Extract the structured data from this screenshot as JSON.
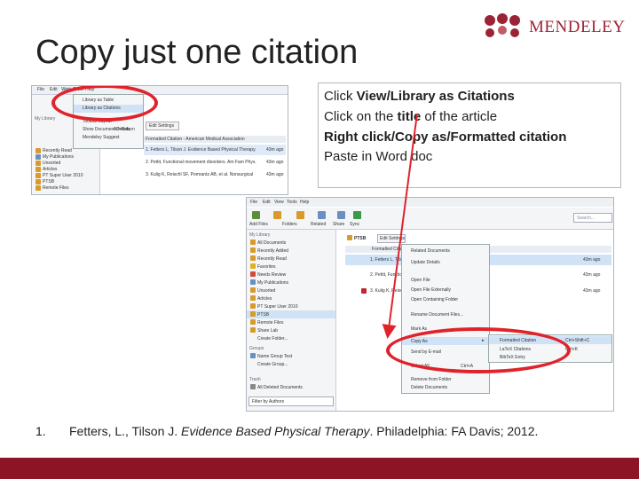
{
  "slide": {
    "title": "Copy just one citation",
    "logo_text": "MENDELEY",
    "brand_color": "#9b2335",
    "bar_color": "#8d1424",
    "annotation_color": "#e0232a"
  },
  "instructions": [
    {
      "text_a": "Click ",
      "text_b": "View/Library as Citations"
    },
    {
      "text_a": "Click on the ",
      "text_b": "title",
      "text_c": " of the article"
    },
    {
      "text_a": "",
      "text_b": "Right click/Copy as/Formatted citation"
    },
    {
      "text_a": "Paste in Word doc",
      "text_b": ""
    }
  ],
  "footnote": {
    "number": "1.",
    "authors": "Fetters, L., Tilson J. ",
    "book_title": "Evidence Based Physical Therapy",
    "publisher": ". Philadelphia: FA Davis; 2012."
  },
  "screenshot1": {
    "menubar": [
      "File",
      "Edit",
      "View",
      "Tools",
      "Help"
    ],
    "cursor_letter": "V",
    "view_menu": [
      "Library as Table",
      "Library as Citations",
      "Toolbar Layout",
      "Show Document Details",
      "Mendeley Suggest"
    ],
    "shortcut": "Alt+Return",
    "sidebar": [
      "My Library",
      "Recently Read",
      "My Publications",
      "Unsorted",
      "Articles",
      "PT Super User 2010",
      "PTSB",
      "Remote Files"
    ],
    "edit_settings": "Edit Settings",
    "style_header": "Formatted Citation - American Medical Association",
    "citations": [
      "1. Fetters L, Tilson J. Evidence Based Physical Therapy.",
      "2. Pettit, Functional movement disorders. Am Fam Phys.",
      "3. Kulig K, Reischl SF, Pomrantz AB, et al. Nonsurgical"
    ],
    "times": [
      "43m ago",
      "43m ago",
      "43m ago"
    ]
  },
  "screenshot2": {
    "menubar": [
      "File",
      "Edit",
      "View",
      "Tools",
      "Help"
    ],
    "toolbar": [
      "Add Files",
      "Folders",
      "Related",
      "Share",
      "Sync"
    ],
    "search_placeholder": "Search...",
    "sidebar_header": "My Library",
    "sidebar": [
      "All Documents",
      "Recently Added",
      "Recently Read",
      "Favorites",
      "Needs Review",
      "My Publications",
      "Unsorted",
      "Articles",
      "PT Super User 2010",
      "PTSB",
      "Remote Files",
      "Share Lab",
      "Create Folder..."
    ],
    "groups_header": "Groups",
    "groups": [
      "Name Group Test",
      "Create Group..."
    ],
    "trash_header": "Trash",
    "trash": [
      "All Deleted Documents"
    ],
    "filter": "Filter by Authors",
    "breadcrumb": "PTSB",
    "edit_settings": "Edit Settings",
    "style_header": "Formatted Citation - American Medical Association",
    "rows": [
      "1. Fetters L, Tilson J. Evidence Based",
      "2. Pettit, Functional",
      "3. Kulig K, Reischl"
    ],
    "times": [
      "43m ago",
      "43m ago",
      "43m ago"
    ],
    "context_menu": [
      "Related Documents",
      "Update Details",
      "Open File",
      "Open File Externally",
      "Open Containing Folder",
      "Rename Document Files...",
      "Mark As",
      "Copy As",
      "Send by E-mail",
      "Select All",
      "Remove from Folder",
      "Delete Documents"
    ],
    "context_shortcuts": {
      "select_all": "Ctrl+A"
    },
    "submenu": [
      {
        "label": "Formatted Citation",
        "shortcut": "Ctrl+Shift+C"
      },
      {
        "label": "LaTeX Citations",
        "shortcut": "Ctrl+K"
      },
      {
        "label": "BibTeX Entry",
        "shortcut": ""
      }
    ]
  }
}
